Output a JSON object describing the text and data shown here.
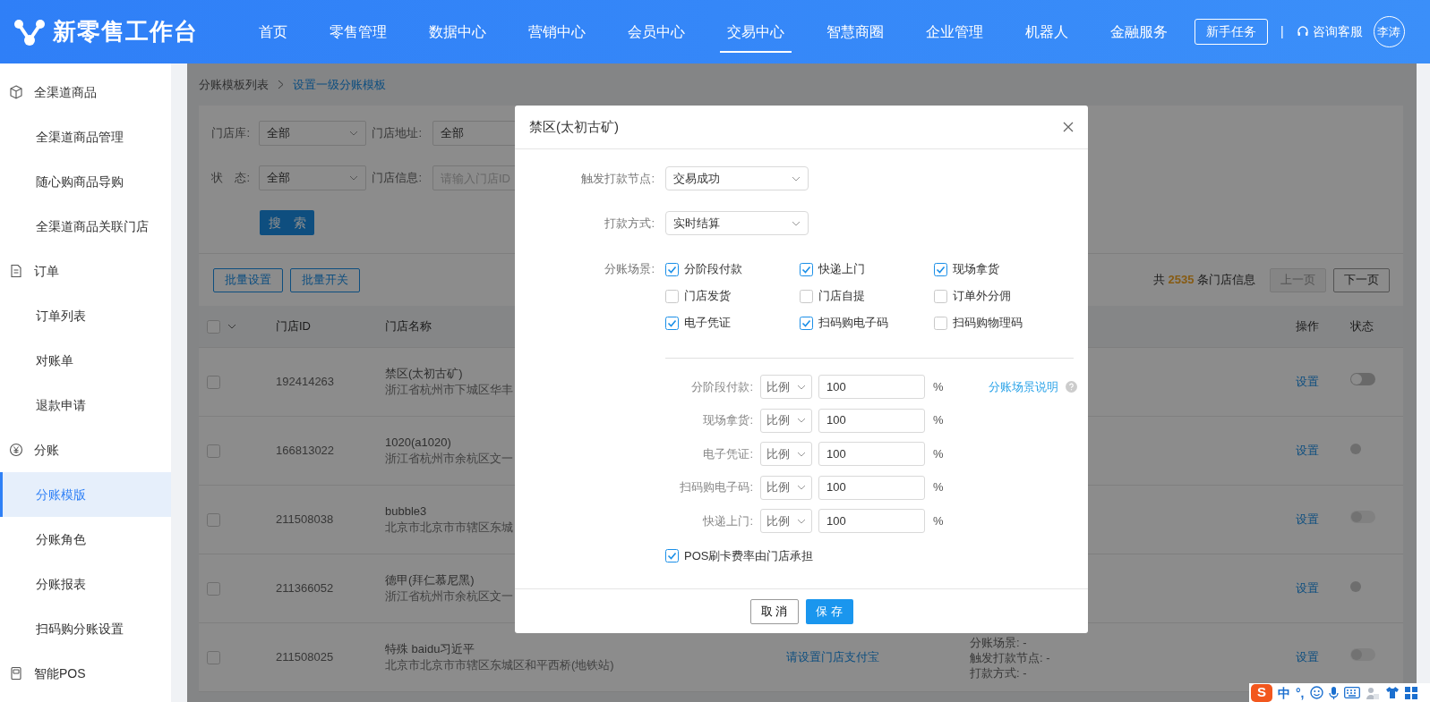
{
  "header": {
    "logo": "新零售工作台",
    "nav": [
      {
        "label": "首页",
        "selected": false
      },
      {
        "label": "零售管理",
        "selected": false
      },
      {
        "label": "数据中心",
        "selected": false
      },
      {
        "label": "营销中心",
        "selected": false
      },
      {
        "label": "会员中心",
        "selected": false
      },
      {
        "label": "交易中心",
        "selected": true
      },
      {
        "label": "智慧商圈",
        "selected": false
      },
      {
        "label": "企业管理",
        "selected": false
      },
      {
        "label": "机器人",
        "selected": false
      },
      {
        "label": "金融服务",
        "selected": false
      }
    ],
    "task_button": "新手任务",
    "separator": "|",
    "service": "咨询客服",
    "avatar": "李涛"
  },
  "sidebar": {
    "groups": [
      {
        "label": "全渠道商品",
        "items": [
          {
            "label": "全渠道商品管理",
            "selected": false
          },
          {
            "label": "随心购商品导购",
            "selected": false
          },
          {
            "label": "全渠道商品关联门店",
            "selected": false
          }
        ]
      },
      {
        "label": "订单",
        "items": [
          {
            "label": "订单列表",
            "selected": false
          },
          {
            "label": "对账单",
            "selected": false
          },
          {
            "label": "退款申请",
            "selected": false
          }
        ]
      },
      {
        "label": "分账",
        "items": [
          {
            "label": "分账模版",
            "selected": true
          },
          {
            "label": "分账角色",
            "selected": false
          },
          {
            "label": "分账报表",
            "selected": false
          },
          {
            "label": "扫码购分账设置",
            "selected": false
          }
        ]
      },
      {
        "label": "智能POS"
      }
    ]
  },
  "breadcrumb": [
    "分账模板列表",
    "设置一级分账模板"
  ],
  "filters": [
    {
      "kind": "select",
      "label": "门店库:",
      "value": "全部"
    },
    {
      "kind": "select",
      "label": "门店地址:",
      "value": "全部"
    },
    {
      "kind": "select",
      "label": "状　态:",
      "value": "全部"
    },
    {
      "kind": "input",
      "label": "门店信息:",
      "placeholder": "请输入门店ID"
    }
  ],
  "search_button": "搜　索",
  "toolbar": {
    "buttons": [
      "批量设置",
      "批量开关"
    ],
    "total": "共 **2535** 条门店信息",
    "prev": {
      "label": "上一页",
      "disabled": true
    },
    "next": {
      "label": "下一页",
      "disabled": false
    }
  },
  "table": {
    "select_all": false,
    "columns": [
      "门店ID",
      "门店名称",
      "操作",
      "状态"
    ],
    "rows": [
      {
        "checked": false,
        "id": "192414263",
        "name": "禁区(太初古矿)",
        "address": "浙江省杭州市下城区华丰",
        "action": "设置",
        "status": {
          "kind": "switch",
          "on": false,
          "disabled": false
        }
      },
      {
        "checked": false,
        "id": "166813022",
        "name": "1020(a1020)",
        "address": "浙江省杭州市余杭区文一",
        "action": "设置",
        "status": {
          "kind": "dot"
        }
      },
      {
        "checked": false,
        "id": "211508038",
        "name": "bubble3",
        "address": "北京市北京市市辖区东城",
        "action": "设置",
        "status": {
          "kind": "switch",
          "on": false,
          "disabled": true
        }
      },
      {
        "checked": false,
        "id": "211366052",
        "name": "德甲(拜仁慕尼黑)",
        "address": "浙江省杭州市余杭区文一",
        "action": "设置",
        "status": {
          "kind": "dot"
        }
      },
      {
        "checked": false,
        "id": "211508025",
        "name": "特殊 baidu习近平",
        "address": "北京市北京市市辖区东城区和平西桥(地铁站)",
        "payment": "请设置门店支付宝",
        "details": [
          "分账场景: -",
          "触发打款节点: -",
          "打款方式: -"
        ],
        "action": "设置",
        "status": {
          "kind": "switch",
          "on": false,
          "disabled": true
        }
      }
    ]
  },
  "modal": {
    "title": "禁区(太初古矿)",
    "fields": [
      {
        "label": "触发打款节点:",
        "value": "交易成功"
      },
      {
        "label": "打款方式:",
        "value": "实时结算"
      }
    ],
    "scenes_label": "分账场景:",
    "scenes": [
      {
        "label": "分阶段付款",
        "checked": true
      },
      {
        "label": "快递上门",
        "checked": true
      },
      {
        "label": "现场拿货",
        "checked": true
      },
      {
        "label": "门店发货",
        "checked": false
      },
      {
        "label": "门店自提",
        "checked": false
      },
      {
        "label": "订单外分佣",
        "checked": false
      },
      {
        "label": "电子凭证",
        "checked": true
      },
      {
        "label": "扫码购电子码",
        "checked": true
      },
      {
        "label": "扫码购物理码",
        "checked": false
      }
    ],
    "ratios": [
      {
        "label": "分阶段付款:",
        "mode": "比例",
        "value": "100",
        "unit": "%"
      },
      {
        "label": "现场拿货:",
        "mode": "比例",
        "value": "100",
        "unit": "%"
      },
      {
        "label": "电子凭证:",
        "mode": "比例",
        "value": "100",
        "unit": "%"
      },
      {
        "label": "扫码购电子码:",
        "mode": "比例",
        "value": "100",
        "unit": "%"
      },
      {
        "label": "快递上门:",
        "mode": "比例",
        "value": "100",
        "unit": "%"
      }
    ],
    "help_link": "分账场景说明",
    "pos_option": {
      "label": "POS刷卡费率由门店承担",
      "checked": true
    },
    "cancel": "取 消",
    "save": "保 存"
  },
  "ime_bar": {
    "logo": "S",
    "items": [
      "中",
      "°,"
    ]
  }
}
